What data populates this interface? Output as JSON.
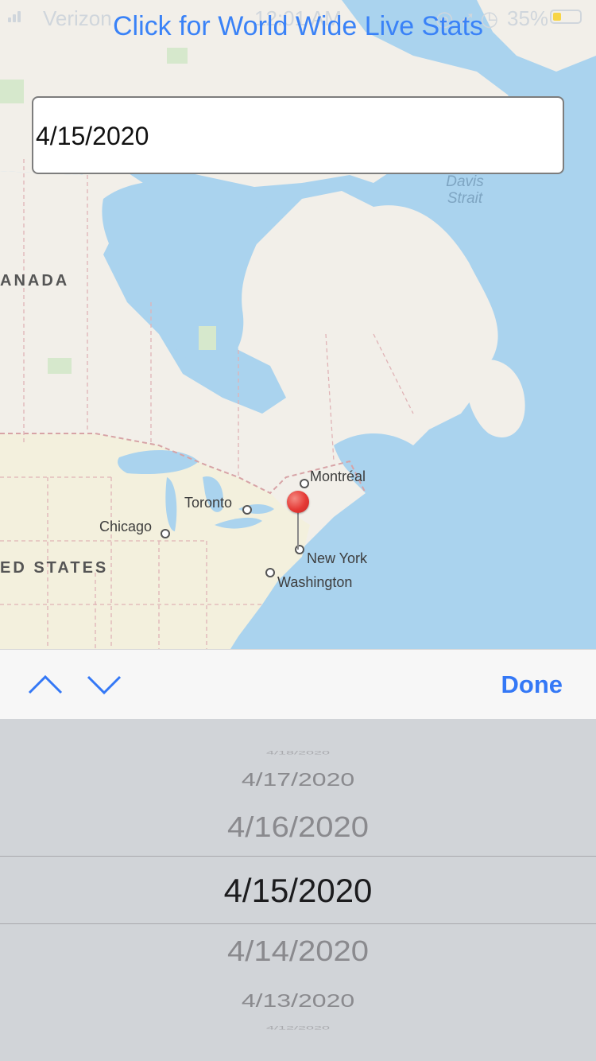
{
  "status_bar": {
    "carrier": "Verizon",
    "time": "12:01 AM",
    "battery_percent": "35%",
    "battery_color": "#f7d548"
  },
  "header": {
    "world_stats_link": "Click for World Wide Live Stats",
    "link_color": "#3a82f7"
  },
  "date_input": {
    "value": "4/15/2020"
  },
  "map": {
    "labels": {
      "water": "Davis\nStrait",
      "canada": "ANADA",
      "usa": "ED STATES",
      "montreal": "Montréal",
      "toronto": "Toronto",
      "chicago": "Chicago",
      "new_york": "New York",
      "washington": "Washington"
    },
    "pin_color": "#e53935"
  },
  "keyboard_toolbar": {
    "prev_icon": "chevron-up-icon",
    "next_icon": "chevron-down-icon",
    "done_label": "Done",
    "accent_color": "#3478f6"
  },
  "date_picker": {
    "options": [
      "4/18/2020",
      "4/17/2020",
      "4/16/2020",
      "4/15/2020",
      "4/14/2020",
      "4/13/2020",
      "4/12/2020"
    ],
    "selected": "4/15/2020"
  }
}
